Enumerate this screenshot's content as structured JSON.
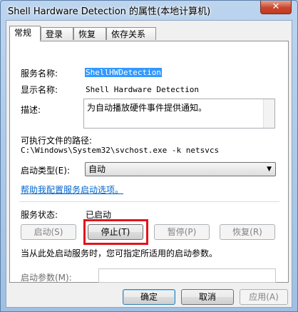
{
  "window": {
    "title": "Shell Hardware Detection 的属性(本地计算机)",
    "close_glyph": "✕"
  },
  "tabs": [
    {
      "label": "常规",
      "active": true
    },
    {
      "label": "登录"
    },
    {
      "label": "恢复"
    },
    {
      "label": "依存关系"
    }
  ],
  "general": {
    "service_name_label": "服务名称:",
    "service_name_value": "ShellHWDetection",
    "display_name_label": "显示名称:",
    "display_name_value": "Shell Hardware Detection",
    "description_label": "描述:",
    "description_value": "为自动播放硬件事件提供通知。",
    "exe_path_label": "可执行文件的路径:",
    "exe_path_value": "C:\\Windows\\System32\\svchost.exe -k netsvcs",
    "startup_type_label": "启动类型(E):",
    "startup_type_value": "自动",
    "help_link": "帮助我配置服务启动选项。",
    "service_status_label": "服务状态:",
    "service_status_value": "已启动",
    "buttons": {
      "start": "启动(S)",
      "stop": "停止(T)",
      "pause": "暂停(P)",
      "resume": "恢复(R)"
    },
    "hint_text": "当从此处启动服务时，您可指定所适用的启动参数。",
    "start_params_label": "启动参数(M):",
    "start_params_value": ""
  },
  "footer": {
    "ok": "确定",
    "cancel": "取消",
    "apply": "应用(A)"
  },
  "colors": {
    "highlight": "#e0141b",
    "link": "#0066cc",
    "selection": "#3399ff"
  }
}
